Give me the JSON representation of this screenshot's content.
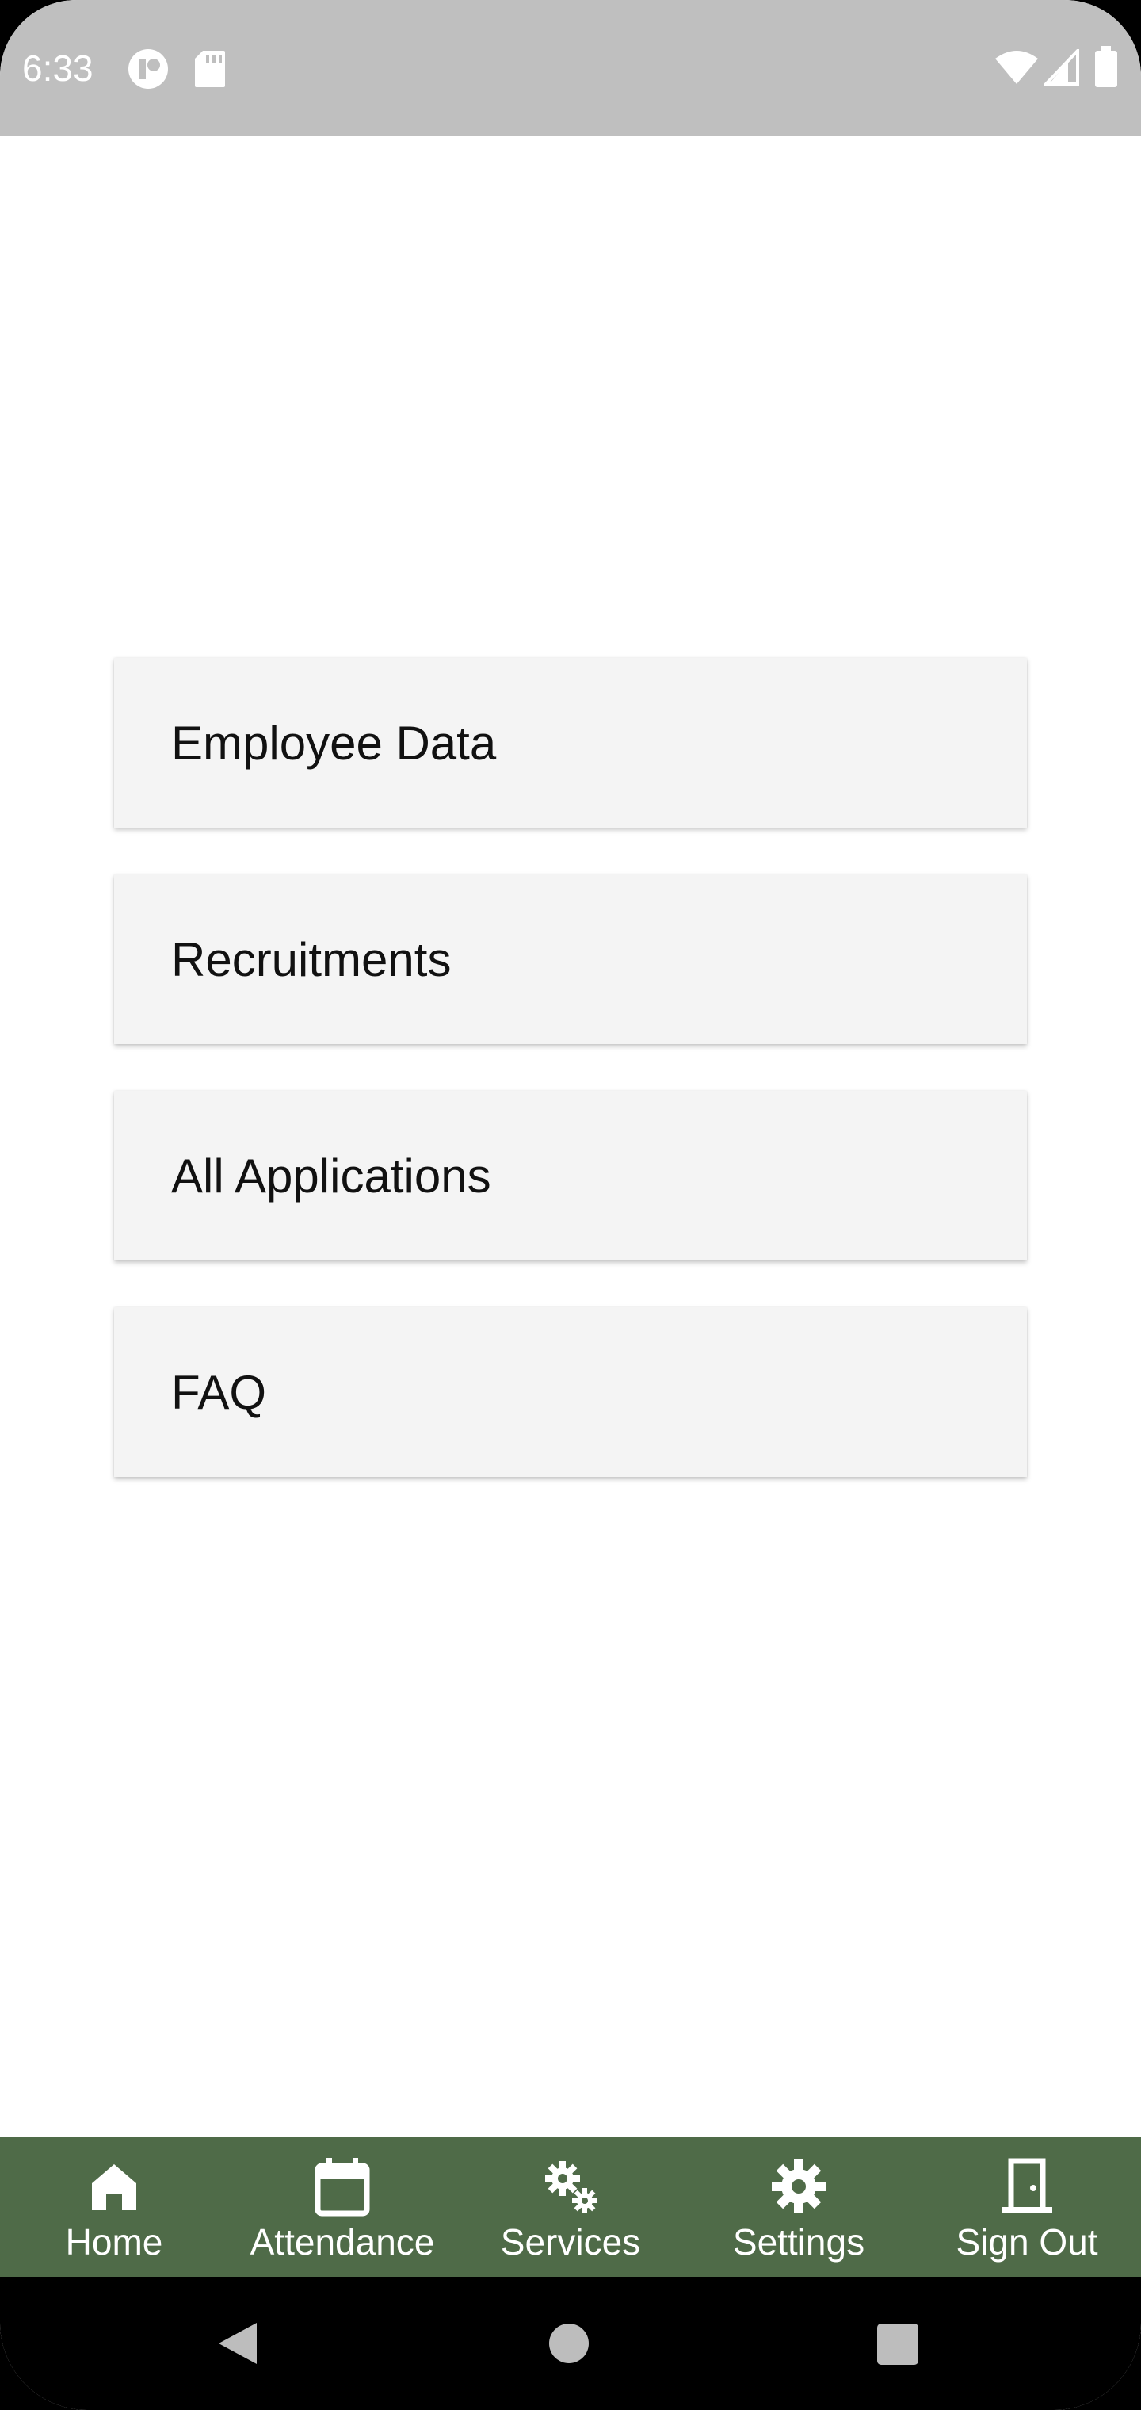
{
  "status_bar": {
    "time": "6:33",
    "left_icons": [
      "circle-app-icon",
      "sd-card-icon"
    ],
    "right_icons": [
      "wifi-icon",
      "cell-signal-icon",
      "battery-icon"
    ],
    "background": "#bfbfbf"
  },
  "menu": {
    "items": [
      {
        "label": "Employee Data"
      },
      {
        "label": "Recruitments"
      },
      {
        "label": "All Applications"
      },
      {
        "label": "FAQ"
      }
    ],
    "card_color": "#f4f4f4"
  },
  "bottom_nav": {
    "background": "#4f6b48",
    "items": [
      {
        "label": "Home",
        "icon": "home-icon"
      },
      {
        "label": "Attendance",
        "icon": "calendar-icon"
      },
      {
        "label": "Services",
        "icon": "gears-icon"
      },
      {
        "label": "Settings",
        "icon": "gear-icon"
      },
      {
        "label": "Sign Out",
        "icon": "door-icon"
      }
    ]
  },
  "system_nav": {
    "buttons": [
      "back-icon",
      "home-circle-icon",
      "recents-icon"
    ]
  }
}
